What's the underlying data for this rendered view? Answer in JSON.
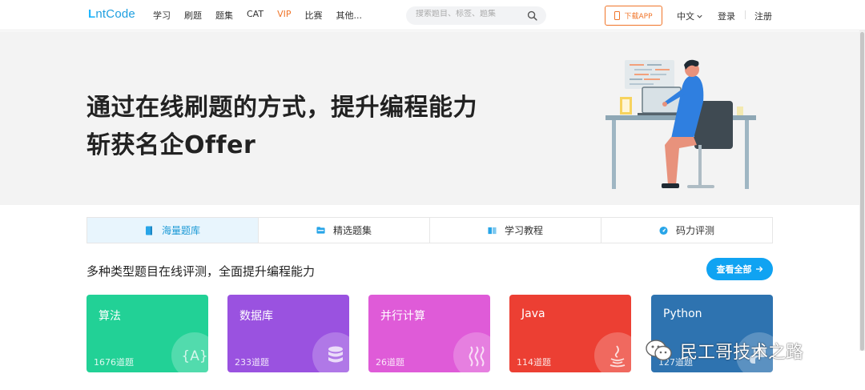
{
  "nav": {
    "logo": {
      "bolt": "L",
      "rest": "ntCode"
    },
    "links": [
      "学习",
      "刷题",
      "题集",
      "CAT",
      "VIP",
      "比赛",
      "其他..."
    ],
    "search_placeholder": "搜索题目、标签、题集",
    "app_button": "下载APP",
    "language": "中文",
    "login": "登录",
    "register": "注册"
  },
  "hero": {
    "line1": "通过在线刷题的方式，提升编程能力",
    "line2": "斩获名企Offer"
  },
  "tabs": [
    {
      "label": "海量题库",
      "icon": "book-icon",
      "active": true
    },
    {
      "label": "精选题集",
      "icon": "folder-icon",
      "active": false
    },
    {
      "label": "学习教程",
      "icon": "open-book-icon",
      "active": false
    },
    {
      "label": "码力评测",
      "icon": "gauge-icon",
      "active": false
    }
  ],
  "section": {
    "title": "多种类型题目在线评测，全面提升编程能力",
    "view_all": "查看全部"
  },
  "cards": [
    {
      "name": "算法",
      "count": "1676道题",
      "color": "#22d196",
      "icon": "algorithm-icon"
    },
    {
      "name": "数据库",
      "count": "233道题",
      "color": "#9a52e0",
      "icon": "database-icon"
    },
    {
      "name": "并行计算",
      "count": "26道题",
      "color": "#df5bd8",
      "icon": "parallel-icon"
    },
    {
      "name": "Java",
      "count": "114道题",
      "color": "#ec3f33",
      "icon": "java-icon"
    },
    {
      "name": "Python",
      "count": "127道题",
      "color": "#2e73b0",
      "icon": "python-icon"
    }
  ],
  "watermark": {
    "text": "民工哥技术之路",
    "icon": "wechat-icon"
  },
  "colors": {
    "brand": "#1e9fe0",
    "accent": "#f07529",
    "primary_button": "#10a3f2"
  }
}
